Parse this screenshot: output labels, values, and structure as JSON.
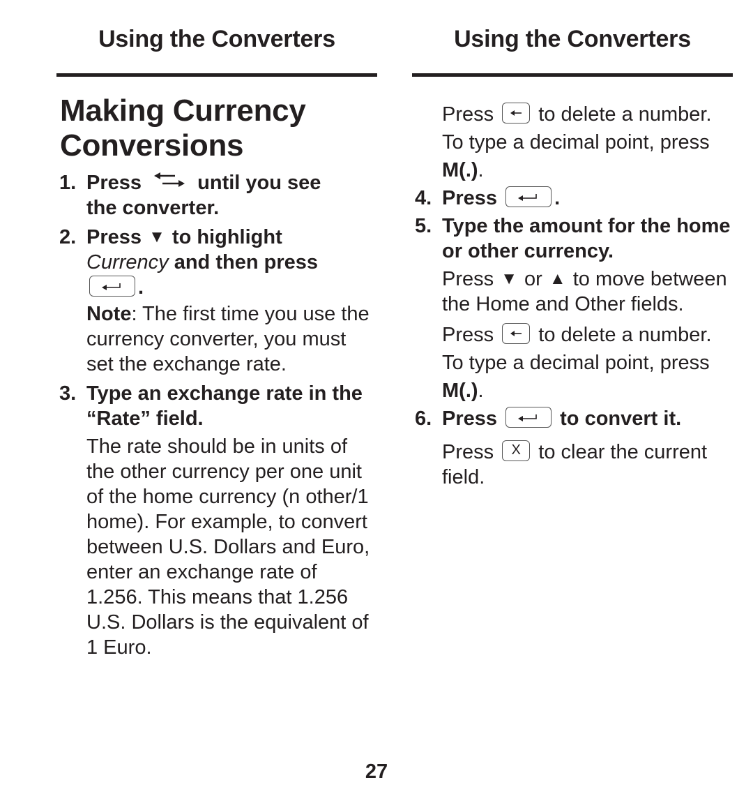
{
  "left_page": {
    "running_head": "Using the Converters",
    "title_line1": "Making Currency",
    "title_line2": "Conversions",
    "steps": [
      {
        "num": "1.",
        "part1": "Press",
        "icon": "swap-arrows-icon",
        "part2": "until you see",
        "part3": "the converter."
      },
      {
        "num": "2.",
        "part1": "Press",
        "icon": "down-triangle-icon",
        "triangle": "▼",
        "part2": "to highlight",
        "italic": "Currency",
        "part3": "and then press",
        "key": "enter-key",
        "end": ".",
        "note_label": "Note",
        "note_text": ": The first time you use the currency converter, you must set the exchange rate."
      },
      {
        "num": "3.",
        "heading": "Type an exchange rate in the “Rate” field.",
        "body": "The rate should be in units of the other currency per one unit of the home currency (n other/1 home). For example, to convert between U.S. Dollars and Euro, enter an exchange rate of 1.256. This means that 1.256 U.S. Dollars is the equivalent of 1 Euro."
      }
    ]
  },
  "right_page": {
    "running_head": "Using the Converters",
    "delete_note_1": {
      "press": "Press",
      "key": "backspace-key",
      "after": "to delete a number. To type a decimal point, press",
      "bold_key": "M(.)",
      "end": "."
    },
    "steps": [
      {
        "num": "4.",
        "press": "Press",
        "key": "enter-key",
        "end": "."
      },
      {
        "num": "5.",
        "heading": "Type the amount for the home or other currency.",
        "body_press": "Press",
        "down": "▼",
        "or": "or",
        "up": "▲",
        "body_rest": "to move between the Home and Other fields."
      },
      {
        "num": "6.",
        "press": "Press",
        "key": "enter-key",
        "after": "to convert it."
      }
    ],
    "delete_note_2": {
      "press": "Press",
      "key": "backspace-key",
      "after": "to delete a number. To type a decimal point, press",
      "bold_key": "M(.)",
      "end": "."
    },
    "clear_note": {
      "press": "Press",
      "key": "clear-key",
      "key_label": "X",
      "after": "to clear the current field."
    }
  },
  "page_number": "27"
}
